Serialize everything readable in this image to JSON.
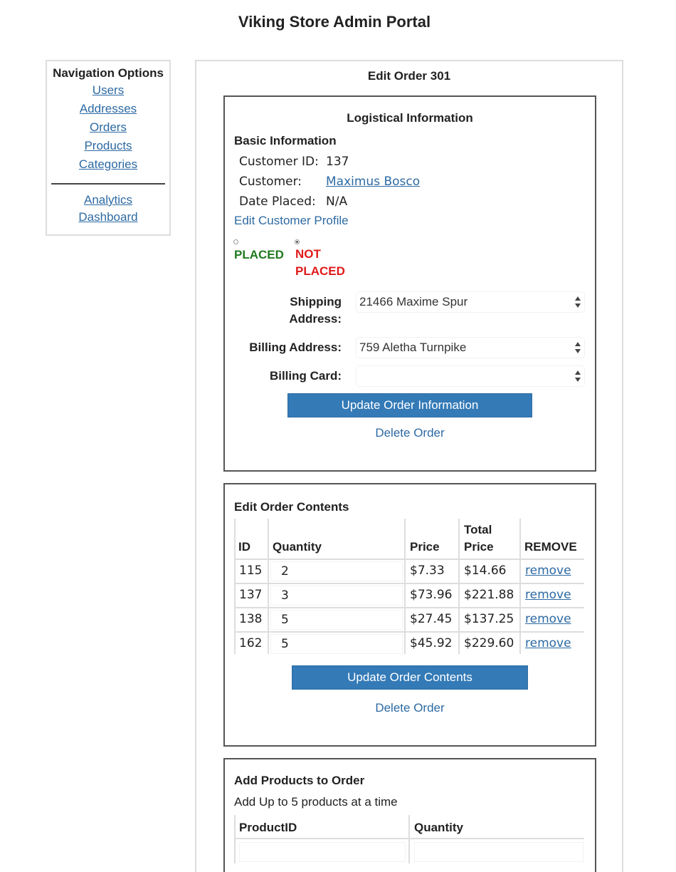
{
  "app": {
    "title": "Viking Store Admin Portal"
  },
  "nav": {
    "heading": "Navigation Options",
    "items": [
      "Users",
      "Addresses",
      "Orders",
      "Products",
      "Categories"
    ],
    "analytics": [
      "Analytics",
      "Dashboard"
    ]
  },
  "main": {
    "title": "Edit Order 301"
  },
  "logistics": {
    "heading": "Logistical Information",
    "basic_heading": "Basic Information",
    "customer_id_label": "Customer ID:",
    "customer_id": "137",
    "customer_label": "Customer:",
    "customer_name": "Maximus Bosco",
    "date_label": "Date Placed:",
    "date_value": "N/A",
    "edit_profile": "Edit Customer Profile",
    "status_placed": "PLACED",
    "status_not": "NOT",
    "status_placed2": "PLACED",
    "shipping_label_1": "Shipping",
    "shipping_label_2": "Address:",
    "shipping_value": "21466 Maxime Spur",
    "billing_label": "Billing Address:",
    "billing_value": "759 Aletha Turnpike",
    "card_label": "Billing Card:",
    "card_value": "",
    "update_button": "Update Order Information",
    "delete_link": "Delete Order"
  },
  "contents": {
    "heading": "Edit Order Contents",
    "columns": {
      "id": "ID",
      "quantity": "Quantity",
      "price": "Price",
      "total_1": "Total",
      "total_2": "Price",
      "remove": "REMOVE"
    },
    "rows": [
      {
        "id": "115",
        "quantity": "2",
        "price": "$7.33",
        "total": "$14.66",
        "remove": "remove"
      },
      {
        "id": "137",
        "quantity": "3",
        "price": "$73.96",
        "total": "$221.88",
        "remove": "remove"
      },
      {
        "id": "138",
        "quantity": "5",
        "price": "$27.45",
        "total": "$137.25",
        "remove": "remove"
      },
      {
        "id": "162",
        "quantity": "5",
        "price": "$45.92",
        "total": "$229.60",
        "remove": "remove"
      }
    ],
    "update_button": "Update Order Contents",
    "delete_link": "Delete Order"
  },
  "add": {
    "heading": "Add Products to Order",
    "subtext": "Add Up to 5 products at a time",
    "col_product": "ProductID",
    "col_quantity": "Quantity"
  }
}
